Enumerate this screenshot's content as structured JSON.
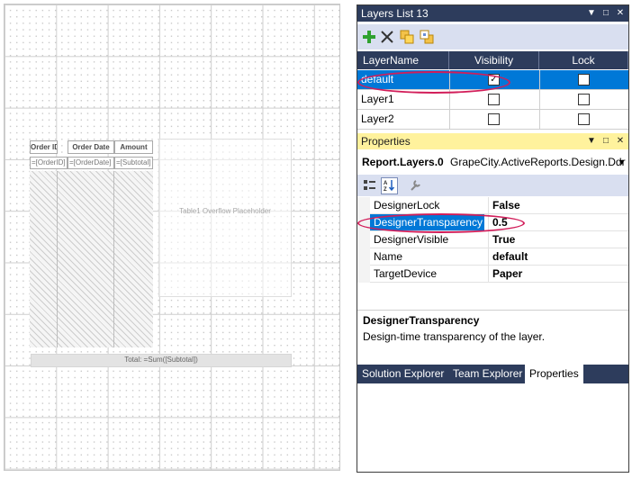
{
  "designer": {
    "table": {
      "headers": [
        "Order ID",
        "Order Date",
        "Amount"
      ],
      "cells": [
        "=[OrderID]",
        "=[OrderDate]",
        "=[Subtotal]"
      ]
    },
    "overflow_placeholder": "Table1 Overflow Placeholder",
    "total_text": "Total:  =Sum([Subtotal])"
  },
  "layers_panel": {
    "title": "Layers List 13",
    "title_buttons": [
      "pin-icon",
      "maximize-icon",
      "close-icon"
    ],
    "toolbar": [
      "add-layer-icon",
      "delete-layer-icon",
      "bring-forward-icon",
      "send-backward-icon"
    ],
    "columns": [
      "LayerName",
      "Visibility",
      "Lock"
    ],
    "rows": [
      {
        "name": "default",
        "visible": true,
        "locked": false,
        "selected": true
      },
      {
        "name": "Layer1",
        "visible": false,
        "locked": false,
        "selected": false
      },
      {
        "name": "Layer2",
        "visible": false,
        "locked": false,
        "selected": false
      }
    ]
  },
  "properties_panel": {
    "title": "Properties",
    "object_name": "Report.Layers.0",
    "object_type": "GrapeCity.ActiveReports.Design.Ddr",
    "toolbar": [
      "categorized-icon",
      "alphabetical-icon",
      "property-pages-icon"
    ],
    "properties": [
      {
        "name": "DesignerLock",
        "value": "False",
        "selected": false
      },
      {
        "name": "DesignerTransparency",
        "value": "0.5",
        "selected": true
      },
      {
        "name": "DesignerVisible",
        "value": "True",
        "selected": false
      },
      {
        "name": "Name",
        "value": "default",
        "selected": false
      },
      {
        "name": "TargetDevice",
        "value": "Paper",
        "selected": false
      }
    ],
    "description_title": "DesignerTransparency",
    "description_text": "Design-time transparency of the layer."
  },
  "bottom_tabs": [
    {
      "label": "Solution Explorer",
      "active": false
    },
    {
      "label": "Team Explorer",
      "active": false
    },
    {
      "label": "Properties",
      "active": true
    }
  ],
  "colors": {
    "panel_dark": "#2d3c5c",
    "properties_title": "#fff29d",
    "selection": "#0078d7",
    "highlight_oval": "#d21e5a"
  }
}
